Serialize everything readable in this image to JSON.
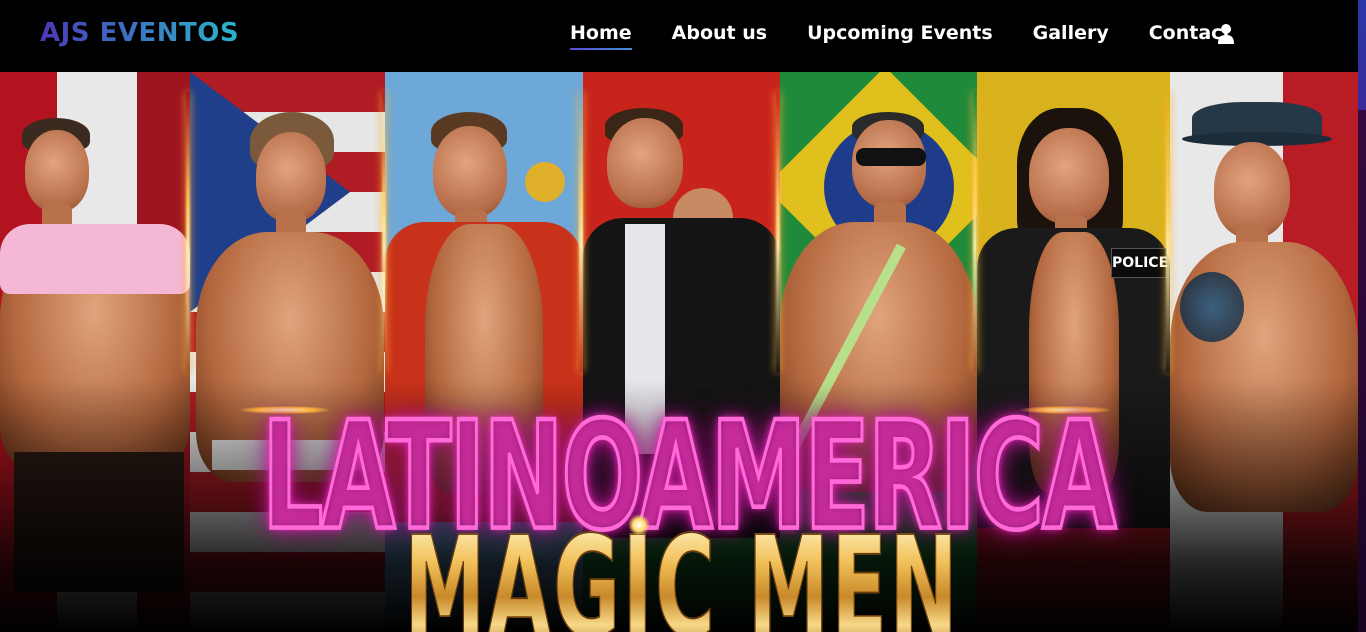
{
  "brand": {
    "name": "AJS EVENTOS"
  },
  "nav": {
    "items": [
      {
        "label": "Home",
        "active": true
      },
      {
        "label": "About us",
        "active": false
      },
      {
        "label": "Upcoming Events",
        "active": false
      },
      {
        "label": "Gallery",
        "active": false
      },
      {
        "label": "Contact",
        "active": false
      }
    ],
    "user_icon": "user-icon"
  },
  "hero": {
    "title_line1": "LATINOAMERICA",
    "title_line2": "MAGIC MEN",
    "panels": [
      {
        "flag": "peru"
      },
      {
        "flag": "puerto-rico"
      },
      {
        "flag": "argentina"
      },
      {
        "flag": "bolivia"
      },
      {
        "flag": "brazil"
      },
      {
        "flag": "colombia"
      },
      {
        "flag": "mexico"
      }
    ]
  },
  "colors": {
    "brand_gradient_start": "#4b38b8",
    "brand_gradient_end": "#2ab5c8",
    "neon_pink": "#ff6ad8",
    "gold": "#f2c15a",
    "background": "#000000"
  }
}
